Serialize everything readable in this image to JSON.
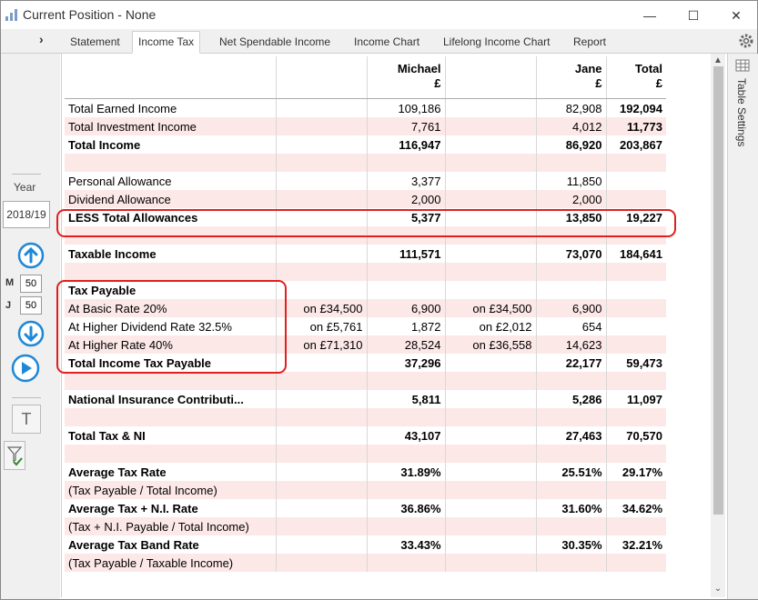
{
  "window": {
    "title": "Current Position - None",
    "min": "—",
    "max": "☐",
    "close": "✕"
  },
  "nav": {
    "chevron": "›"
  },
  "tabs": [
    "Statement",
    "Income Tax",
    "Net Spendable Income",
    "Income Chart",
    "Lifelong Income Chart",
    "Report"
  ],
  "active_tab": "Income Tax",
  "left": {
    "year_label": "Year",
    "year_value": "2018/19",
    "m_label": "M",
    "m_value": "50",
    "j_label": "J",
    "j_value": "50",
    "t_label": "T"
  },
  "side_panel": {
    "label": "Table Settings"
  },
  "table": {
    "header": {
      "col1": "Michael\n£",
      "col2": "Jane\n£",
      "col3": "Total\n£"
    },
    "rows": [
      {
        "type": "data",
        "alt": false,
        "bold": false,
        "label": "Total Earned Income",
        "m_note": "",
        "m": "109,186",
        "j_note": "",
        "j": "82,908",
        "t": "192,094",
        "t_bold": true
      },
      {
        "type": "data",
        "alt": true,
        "bold": false,
        "label": "Total Investment Income",
        "m_note": "",
        "m": "7,761",
        "j_note": "",
        "j": "4,012",
        "t": "11,773",
        "t_bold": true
      },
      {
        "type": "data",
        "alt": false,
        "bold": true,
        "label": "Total Income",
        "m_note": "",
        "m": "116,947",
        "j_note": "",
        "j": "86,920",
        "t": "203,867"
      },
      {
        "type": "blank",
        "alt": true
      },
      {
        "type": "data",
        "alt": false,
        "bold": false,
        "label": "Personal Allowance",
        "m_note": "",
        "m": "3,377",
        "j_note": "",
        "j": "11,850",
        "t": ""
      },
      {
        "type": "data",
        "alt": true,
        "bold": false,
        "label": "Dividend Allowance",
        "m_note": "",
        "m": "2,000",
        "j_note": "",
        "j": "2,000",
        "t": ""
      },
      {
        "type": "data",
        "alt": false,
        "bold": true,
        "label": "LESS Total Allowances",
        "m_note": "",
        "m": "5,377",
        "j_note": "",
        "j": "13,850",
        "t": "19,227"
      },
      {
        "type": "blank",
        "alt": true
      },
      {
        "type": "data",
        "alt": false,
        "bold": true,
        "label": "Taxable Income",
        "m_note": "",
        "m": "111,571",
        "j_note": "",
        "j": "73,070",
        "t": "184,641"
      },
      {
        "type": "blank",
        "alt": true
      },
      {
        "type": "data",
        "alt": false,
        "bold": true,
        "label": "Tax Payable",
        "m_note": "",
        "m": "",
        "j_note": "",
        "j": "",
        "t": ""
      },
      {
        "type": "data",
        "alt": true,
        "bold": false,
        "label": "At Basic Rate 20%",
        "m_note": "on £34,500",
        "m": "6,900",
        "j_note": "on £34,500",
        "j": "6,900",
        "t": ""
      },
      {
        "type": "data",
        "alt": false,
        "bold": false,
        "label": "At Higher Dividend Rate 32.5%",
        "m_note": "on £5,761",
        "m": "1,872",
        "j_note": "on £2,012",
        "j": "654",
        "t": ""
      },
      {
        "type": "data",
        "alt": true,
        "bold": false,
        "label": "At Higher Rate 40%",
        "m_note": "on £71,310",
        "m": "28,524",
        "j_note": "on £36,558",
        "j": "14,623",
        "t": ""
      },
      {
        "type": "data",
        "alt": false,
        "bold": true,
        "label": "Total Income Tax Payable",
        "m_note": "",
        "m": "37,296",
        "j_note": "",
        "j": "22,177",
        "t": "59,473"
      },
      {
        "type": "blank",
        "alt": true
      },
      {
        "type": "data",
        "alt": false,
        "bold": true,
        "label": "National Insurance Contributi...",
        "m_note": "",
        "m": "5,811",
        "j_note": "",
        "j": "5,286",
        "t": "11,097"
      },
      {
        "type": "blank",
        "alt": true
      },
      {
        "type": "data",
        "alt": false,
        "bold": true,
        "label": "Total Tax & NI",
        "m_note": "",
        "m": "43,107",
        "j_note": "",
        "j": "27,463",
        "t": "70,570"
      },
      {
        "type": "blank",
        "alt": true
      },
      {
        "type": "data",
        "alt": false,
        "bold": true,
        "label": "Average Tax Rate",
        "m_note": "",
        "m": "31.89%",
        "j_note": "",
        "j": "25.51%",
        "t": "29.17%"
      },
      {
        "type": "data",
        "alt": true,
        "bold": false,
        "label": "(Tax Payable / Total Income)",
        "m_note": "",
        "m": "",
        "j_note": "",
        "j": "",
        "t": ""
      },
      {
        "type": "data",
        "alt": false,
        "bold": true,
        "label": "Average Tax + N.I. Rate",
        "m_note": "",
        "m": "36.86%",
        "j_note": "",
        "j": "31.60%",
        "t": "34.62%"
      },
      {
        "type": "data",
        "alt": true,
        "bold": false,
        "label": "(Tax + N.I. Payable / Total Income)",
        "m_note": "",
        "m": "",
        "j_note": "",
        "j": "",
        "t": ""
      },
      {
        "type": "data",
        "alt": false,
        "bold": true,
        "label": "Average Tax Band Rate",
        "m_note": "",
        "m": "33.43%",
        "j_note": "",
        "j": "30.35%",
        "t": "32.21%"
      },
      {
        "type": "data",
        "alt": true,
        "bold": false,
        "label": "(Tax Payable / Taxable Income)",
        "m_note": "",
        "m": "",
        "j_note": "",
        "j": "",
        "t": ""
      }
    ]
  },
  "colors": {
    "row_alt": "#fde8e8",
    "highlight": "#e02020",
    "accent": "#1e88d6"
  }
}
